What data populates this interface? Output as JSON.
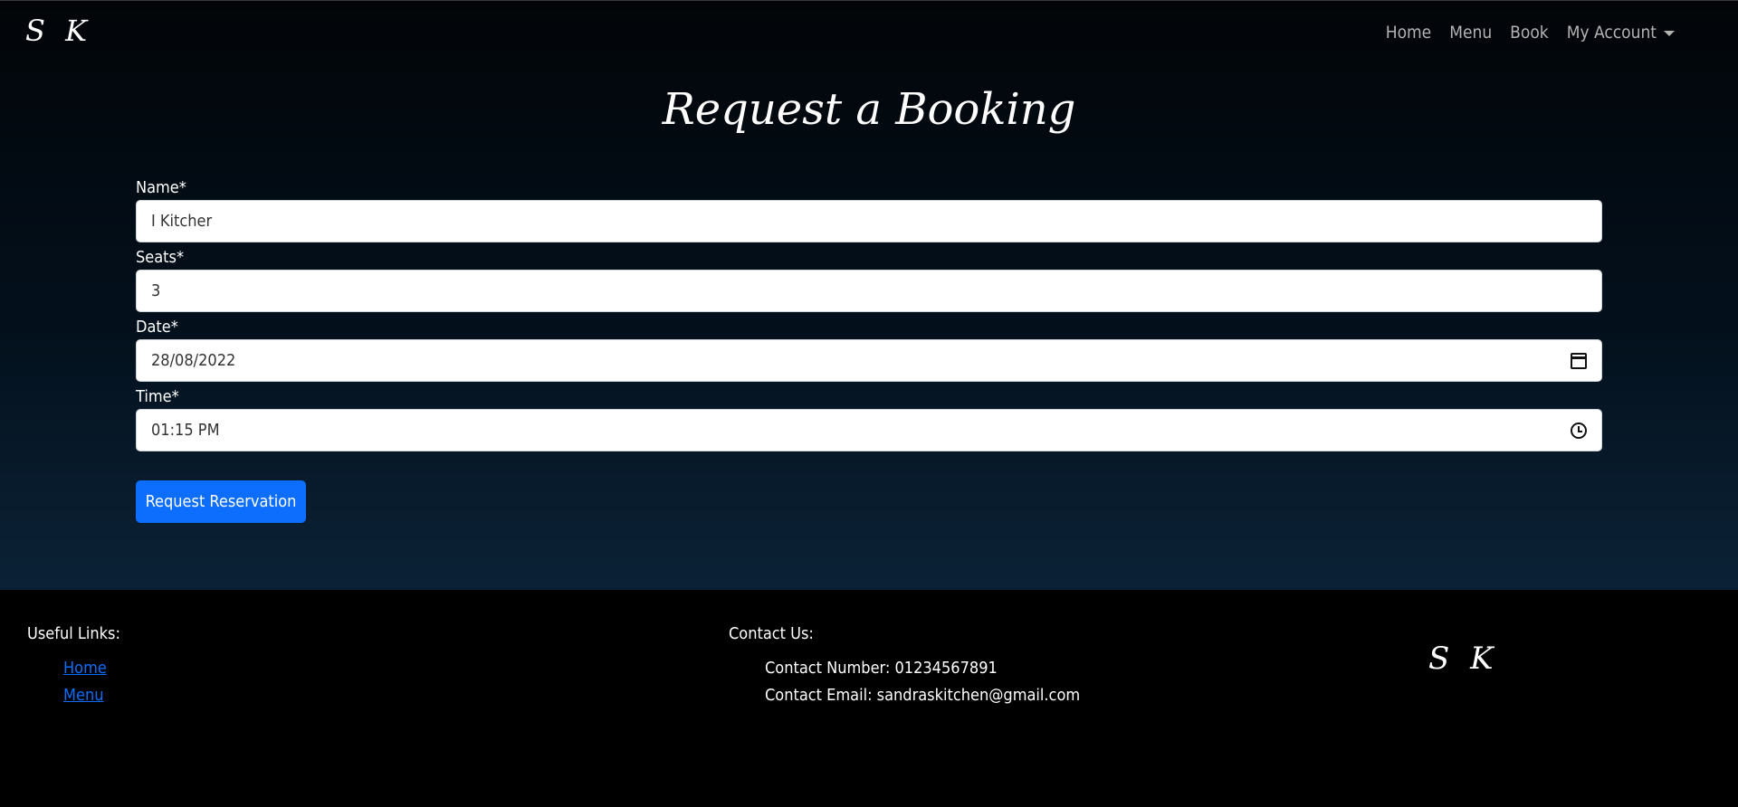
{
  "header": {
    "brand": "S K",
    "nav": {
      "home": "Home",
      "menu": "Menu",
      "book": "Book",
      "account": "My Account"
    }
  },
  "page": {
    "title": "Request a Booking"
  },
  "form": {
    "name": {
      "label": "Name*",
      "value": "I Kitcher"
    },
    "seats": {
      "label": "Seats*",
      "value": "3"
    },
    "date": {
      "label": "Date*",
      "value": "28/08/2022"
    },
    "time": {
      "label": "Time*",
      "value": "01:15 PM"
    },
    "submit_label": "Request Reservation"
  },
  "footer": {
    "links_heading": "Useful Links:",
    "links": [
      "Home",
      "Menu"
    ],
    "contact_heading": "Contact Us:",
    "contact_number": "Contact Number: 01234567891",
    "contact_email": "Contact Email: sandraskitchen@gmail.com",
    "brand": "S K"
  },
  "colors": {
    "accent": "#0d6efd",
    "background": "#000000"
  }
}
